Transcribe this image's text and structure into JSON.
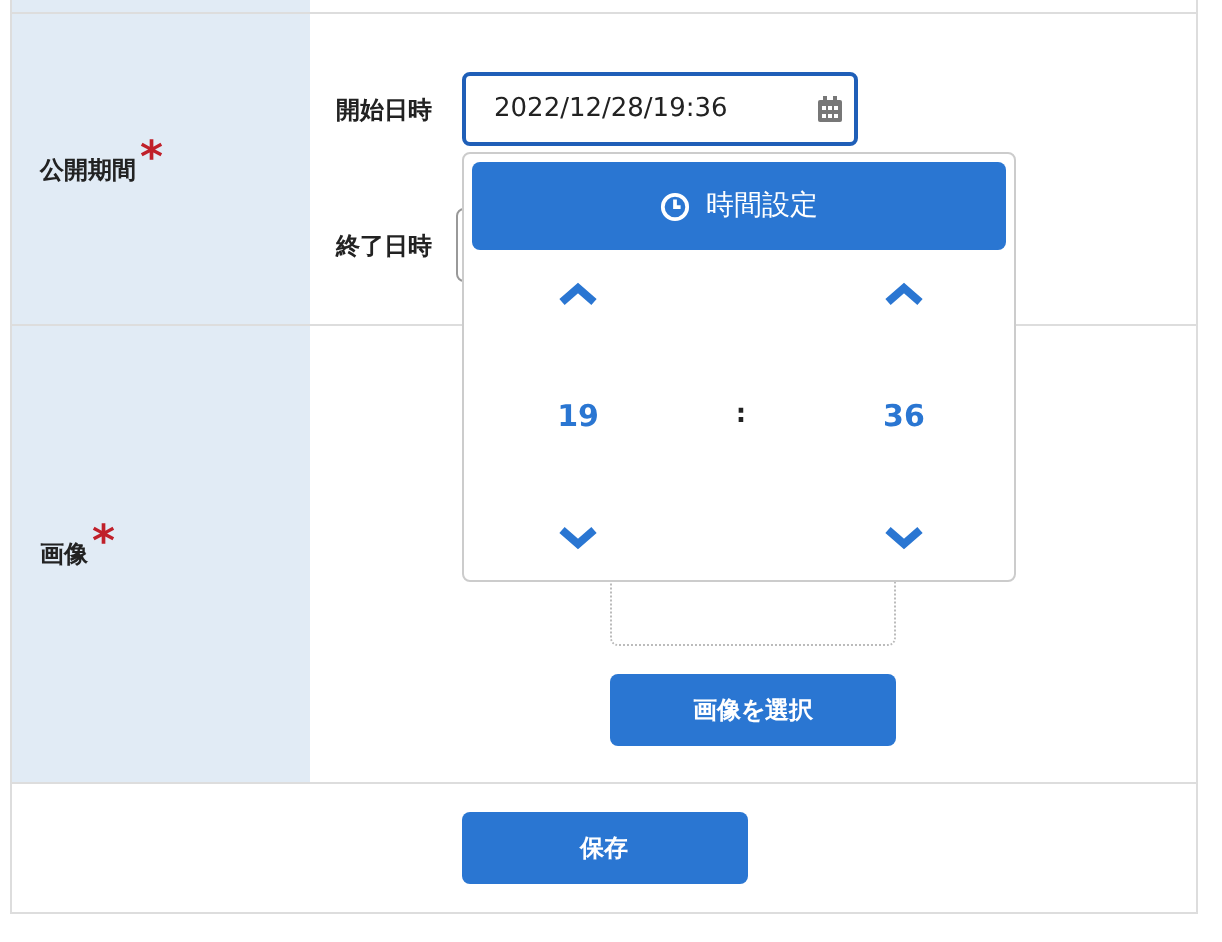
{
  "period": {
    "label": "公開期間",
    "required_mark": "*",
    "start": {
      "label": "開始日時",
      "value": "2022/12/28/19:36",
      "focused": true
    },
    "end": {
      "label": "終了日時"
    }
  },
  "time_picker": {
    "title": "時間設定",
    "hour": "19",
    "separator": ":",
    "minute": "36"
  },
  "image": {
    "label": "画像",
    "required_mark": "*",
    "select_button": "画像を選択"
  },
  "save_button": "保存"
}
